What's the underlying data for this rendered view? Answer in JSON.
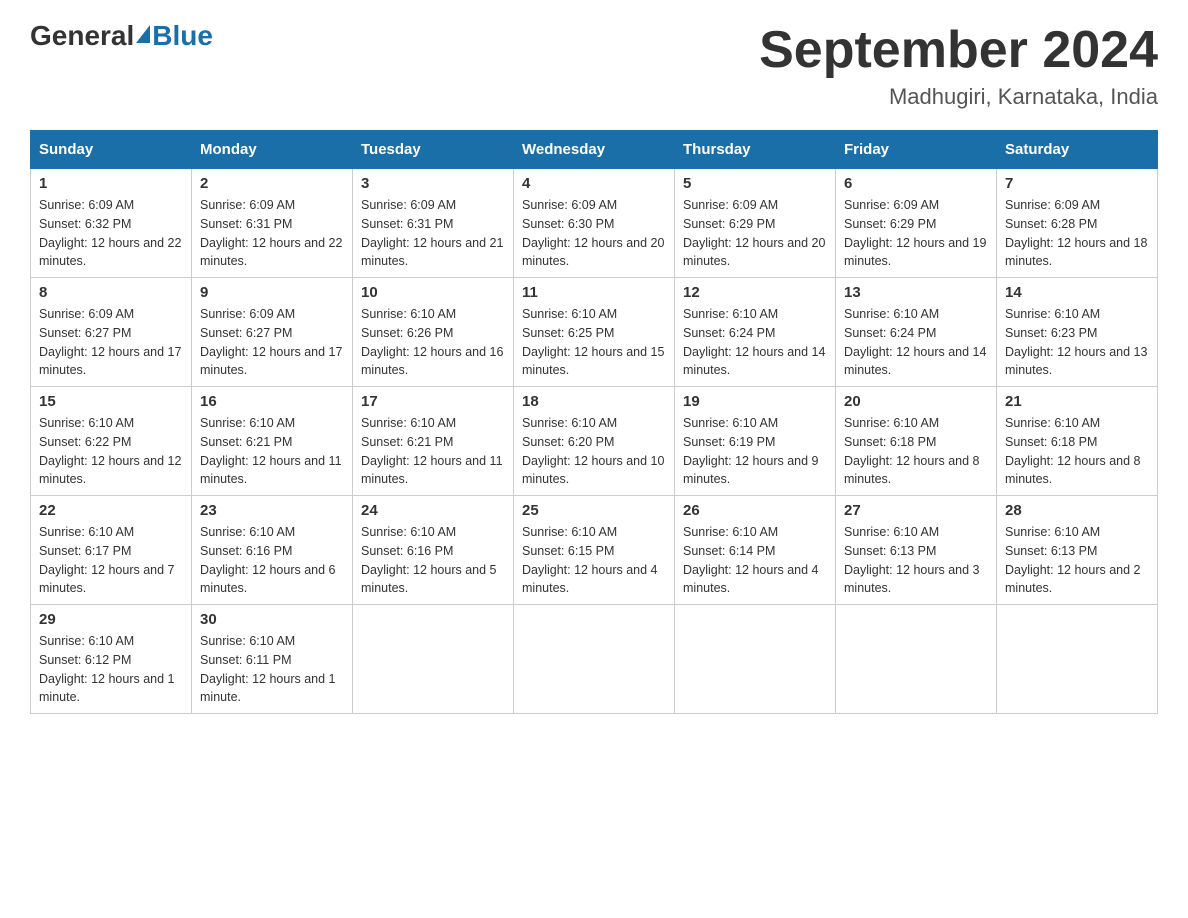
{
  "logo": {
    "general": "General",
    "blue": "Blue"
  },
  "title": "September 2024",
  "subtitle": "Madhugiri, Karnataka, India",
  "days_of_week": [
    "Sunday",
    "Monday",
    "Tuesday",
    "Wednesday",
    "Thursday",
    "Friday",
    "Saturday"
  ],
  "weeks": [
    [
      {
        "day": "1",
        "sunrise": "Sunrise: 6:09 AM",
        "sunset": "Sunset: 6:32 PM",
        "daylight": "Daylight: 12 hours and 22 minutes."
      },
      {
        "day": "2",
        "sunrise": "Sunrise: 6:09 AM",
        "sunset": "Sunset: 6:31 PM",
        "daylight": "Daylight: 12 hours and 22 minutes."
      },
      {
        "day": "3",
        "sunrise": "Sunrise: 6:09 AM",
        "sunset": "Sunset: 6:31 PM",
        "daylight": "Daylight: 12 hours and 21 minutes."
      },
      {
        "day": "4",
        "sunrise": "Sunrise: 6:09 AM",
        "sunset": "Sunset: 6:30 PM",
        "daylight": "Daylight: 12 hours and 20 minutes."
      },
      {
        "day": "5",
        "sunrise": "Sunrise: 6:09 AM",
        "sunset": "Sunset: 6:29 PM",
        "daylight": "Daylight: 12 hours and 20 minutes."
      },
      {
        "day": "6",
        "sunrise": "Sunrise: 6:09 AM",
        "sunset": "Sunset: 6:29 PM",
        "daylight": "Daylight: 12 hours and 19 minutes."
      },
      {
        "day": "7",
        "sunrise": "Sunrise: 6:09 AM",
        "sunset": "Sunset: 6:28 PM",
        "daylight": "Daylight: 12 hours and 18 minutes."
      }
    ],
    [
      {
        "day": "8",
        "sunrise": "Sunrise: 6:09 AM",
        "sunset": "Sunset: 6:27 PM",
        "daylight": "Daylight: 12 hours and 17 minutes."
      },
      {
        "day": "9",
        "sunrise": "Sunrise: 6:09 AM",
        "sunset": "Sunset: 6:27 PM",
        "daylight": "Daylight: 12 hours and 17 minutes."
      },
      {
        "day": "10",
        "sunrise": "Sunrise: 6:10 AM",
        "sunset": "Sunset: 6:26 PM",
        "daylight": "Daylight: 12 hours and 16 minutes."
      },
      {
        "day": "11",
        "sunrise": "Sunrise: 6:10 AM",
        "sunset": "Sunset: 6:25 PM",
        "daylight": "Daylight: 12 hours and 15 minutes."
      },
      {
        "day": "12",
        "sunrise": "Sunrise: 6:10 AM",
        "sunset": "Sunset: 6:24 PM",
        "daylight": "Daylight: 12 hours and 14 minutes."
      },
      {
        "day": "13",
        "sunrise": "Sunrise: 6:10 AM",
        "sunset": "Sunset: 6:24 PM",
        "daylight": "Daylight: 12 hours and 14 minutes."
      },
      {
        "day": "14",
        "sunrise": "Sunrise: 6:10 AM",
        "sunset": "Sunset: 6:23 PM",
        "daylight": "Daylight: 12 hours and 13 minutes."
      }
    ],
    [
      {
        "day": "15",
        "sunrise": "Sunrise: 6:10 AM",
        "sunset": "Sunset: 6:22 PM",
        "daylight": "Daylight: 12 hours and 12 minutes."
      },
      {
        "day": "16",
        "sunrise": "Sunrise: 6:10 AM",
        "sunset": "Sunset: 6:21 PM",
        "daylight": "Daylight: 12 hours and 11 minutes."
      },
      {
        "day": "17",
        "sunrise": "Sunrise: 6:10 AM",
        "sunset": "Sunset: 6:21 PM",
        "daylight": "Daylight: 12 hours and 11 minutes."
      },
      {
        "day": "18",
        "sunrise": "Sunrise: 6:10 AM",
        "sunset": "Sunset: 6:20 PM",
        "daylight": "Daylight: 12 hours and 10 minutes."
      },
      {
        "day": "19",
        "sunrise": "Sunrise: 6:10 AM",
        "sunset": "Sunset: 6:19 PM",
        "daylight": "Daylight: 12 hours and 9 minutes."
      },
      {
        "day": "20",
        "sunrise": "Sunrise: 6:10 AM",
        "sunset": "Sunset: 6:18 PM",
        "daylight": "Daylight: 12 hours and 8 minutes."
      },
      {
        "day": "21",
        "sunrise": "Sunrise: 6:10 AM",
        "sunset": "Sunset: 6:18 PM",
        "daylight": "Daylight: 12 hours and 8 minutes."
      }
    ],
    [
      {
        "day": "22",
        "sunrise": "Sunrise: 6:10 AM",
        "sunset": "Sunset: 6:17 PM",
        "daylight": "Daylight: 12 hours and 7 minutes."
      },
      {
        "day": "23",
        "sunrise": "Sunrise: 6:10 AM",
        "sunset": "Sunset: 6:16 PM",
        "daylight": "Daylight: 12 hours and 6 minutes."
      },
      {
        "day": "24",
        "sunrise": "Sunrise: 6:10 AM",
        "sunset": "Sunset: 6:16 PM",
        "daylight": "Daylight: 12 hours and 5 minutes."
      },
      {
        "day": "25",
        "sunrise": "Sunrise: 6:10 AM",
        "sunset": "Sunset: 6:15 PM",
        "daylight": "Daylight: 12 hours and 4 minutes."
      },
      {
        "day": "26",
        "sunrise": "Sunrise: 6:10 AM",
        "sunset": "Sunset: 6:14 PM",
        "daylight": "Daylight: 12 hours and 4 minutes."
      },
      {
        "day": "27",
        "sunrise": "Sunrise: 6:10 AM",
        "sunset": "Sunset: 6:13 PM",
        "daylight": "Daylight: 12 hours and 3 minutes."
      },
      {
        "day": "28",
        "sunrise": "Sunrise: 6:10 AM",
        "sunset": "Sunset: 6:13 PM",
        "daylight": "Daylight: 12 hours and 2 minutes."
      }
    ],
    [
      {
        "day": "29",
        "sunrise": "Sunrise: 6:10 AM",
        "sunset": "Sunset: 6:12 PM",
        "daylight": "Daylight: 12 hours and 1 minute."
      },
      {
        "day": "30",
        "sunrise": "Sunrise: 6:10 AM",
        "sunset": "Sunset: 6:11 PM",
        "daylight": "Daylight: 12 hours and 1 minute."
      },
      null,
      null,
      null,
      null,
      null
    ]
  ]
}
